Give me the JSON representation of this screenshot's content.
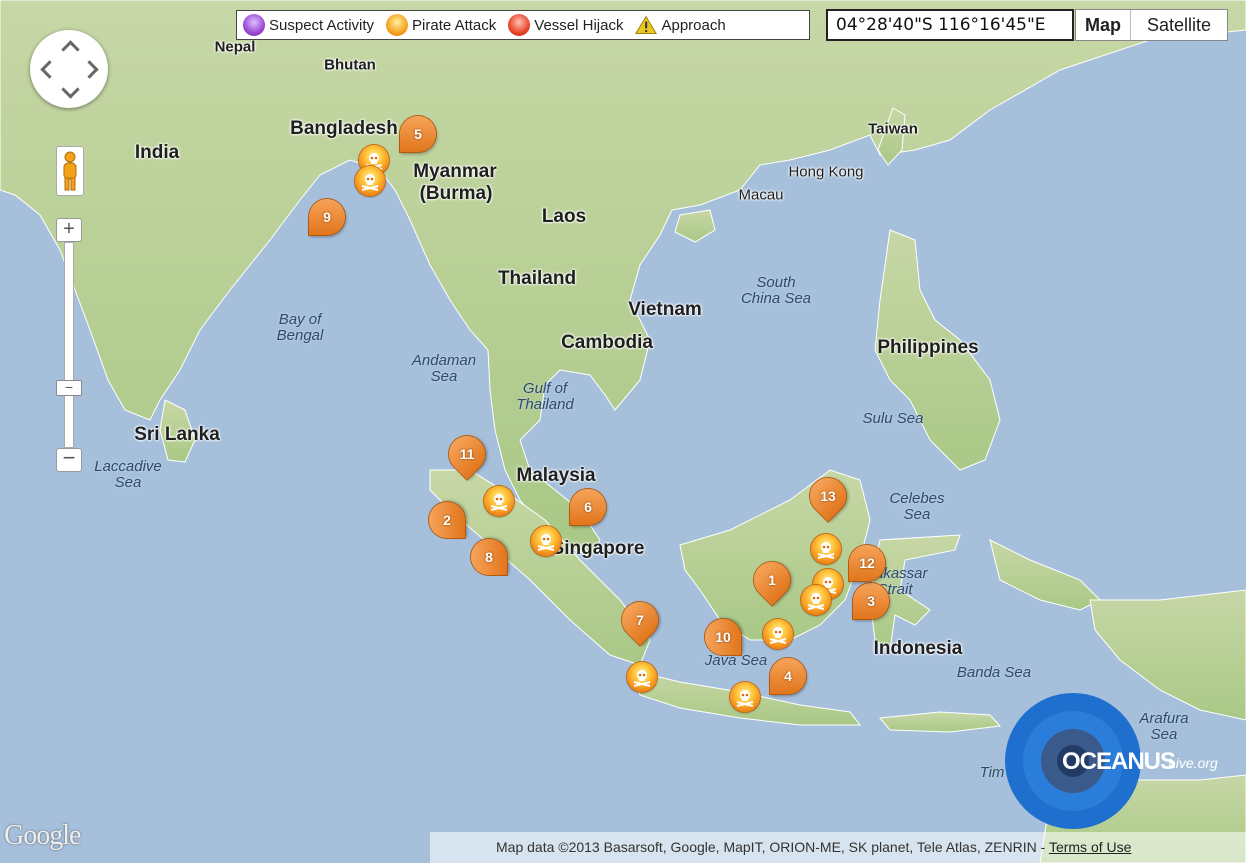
{
  "legend": {
    "items": [
      {
        "label": "Suspect Activity",
        "icon": "purple-skull-icon",
        "color": "#9b49d6"
      },
      {
        "label": "Pirate Attack",
        "icon": "orange-skull-icon",
        "color": "#f7a21f"
      },
      {
        "label": "Vessel Hijack",
        "icon": "red-skull-icon",
        "color": "#e8452a"
      },
      {
        "label": "Approach",
        "icon": "warning-triangle-icon",
        "color": "#e8c81a"
      }
    ]
  },
  "coordinates": "04°28'40\"S   116°16'45\"E",
  "map_type": {
    "map": "Map",
    "satellite": "Satellite"
  },
  "controls": {
    "zoom_in": "+",
    "zoom_out": "−",
    "zoom_thumb": "−"
  },
  "labels": {
    "countries": [
      "India",
      "Bangladesh",
      "Myanmar",
      "(Burma)",
      "Nepal",
      "Bhutan",
      "Laos",
      "Thailand",
      "Vietnam",
      "Cambodia",
      "Malaysia",
      "Philippines",
      "Indonesia",
      "Sri Lanka",
      "Taiwan",
      "Singapore"
    ],
    "cities": [
      "Hong Kong",
      "Macau"
    ],
    "seas": [
      "Bay of\nBengal",
      "Andaman\nSea",
      "Gulf of\nThailand",
      "South\nChina Sea",
      "Sulu Sea",
      "Celebes\nSea",
      "Laccadive\nSea",
      "Java Sea",
      "Banda Sea",
      "Arafura\nSea",
      "Tim",
      "Makassar\nStrait"
    ]
  },
  "markers": [
    "1",
    "2",
    "3",
    "4",
    "5",
    "6",
    "7",
    "8",
    "9",
    "10",
    "11",
    "12",
    "13"
  ],
  "footer": {
    "google": "Google",
    "attribution": "Map data ©2013 Basarsoft, Google, MapIT, ORION-ME, SK planet, Tele Atlas, ZENRIN - ",
    "terms": "Terms of Use"
  },
  "logo": {
    "main": "OCEANUS",
    "sub": "Live.org"
  },
  "colors": {
    "water": "#a6c0dc",
    "land": "#b9d398",
    "marker": "#f28a1a",
    "border": "#ffffff"
  }
}
